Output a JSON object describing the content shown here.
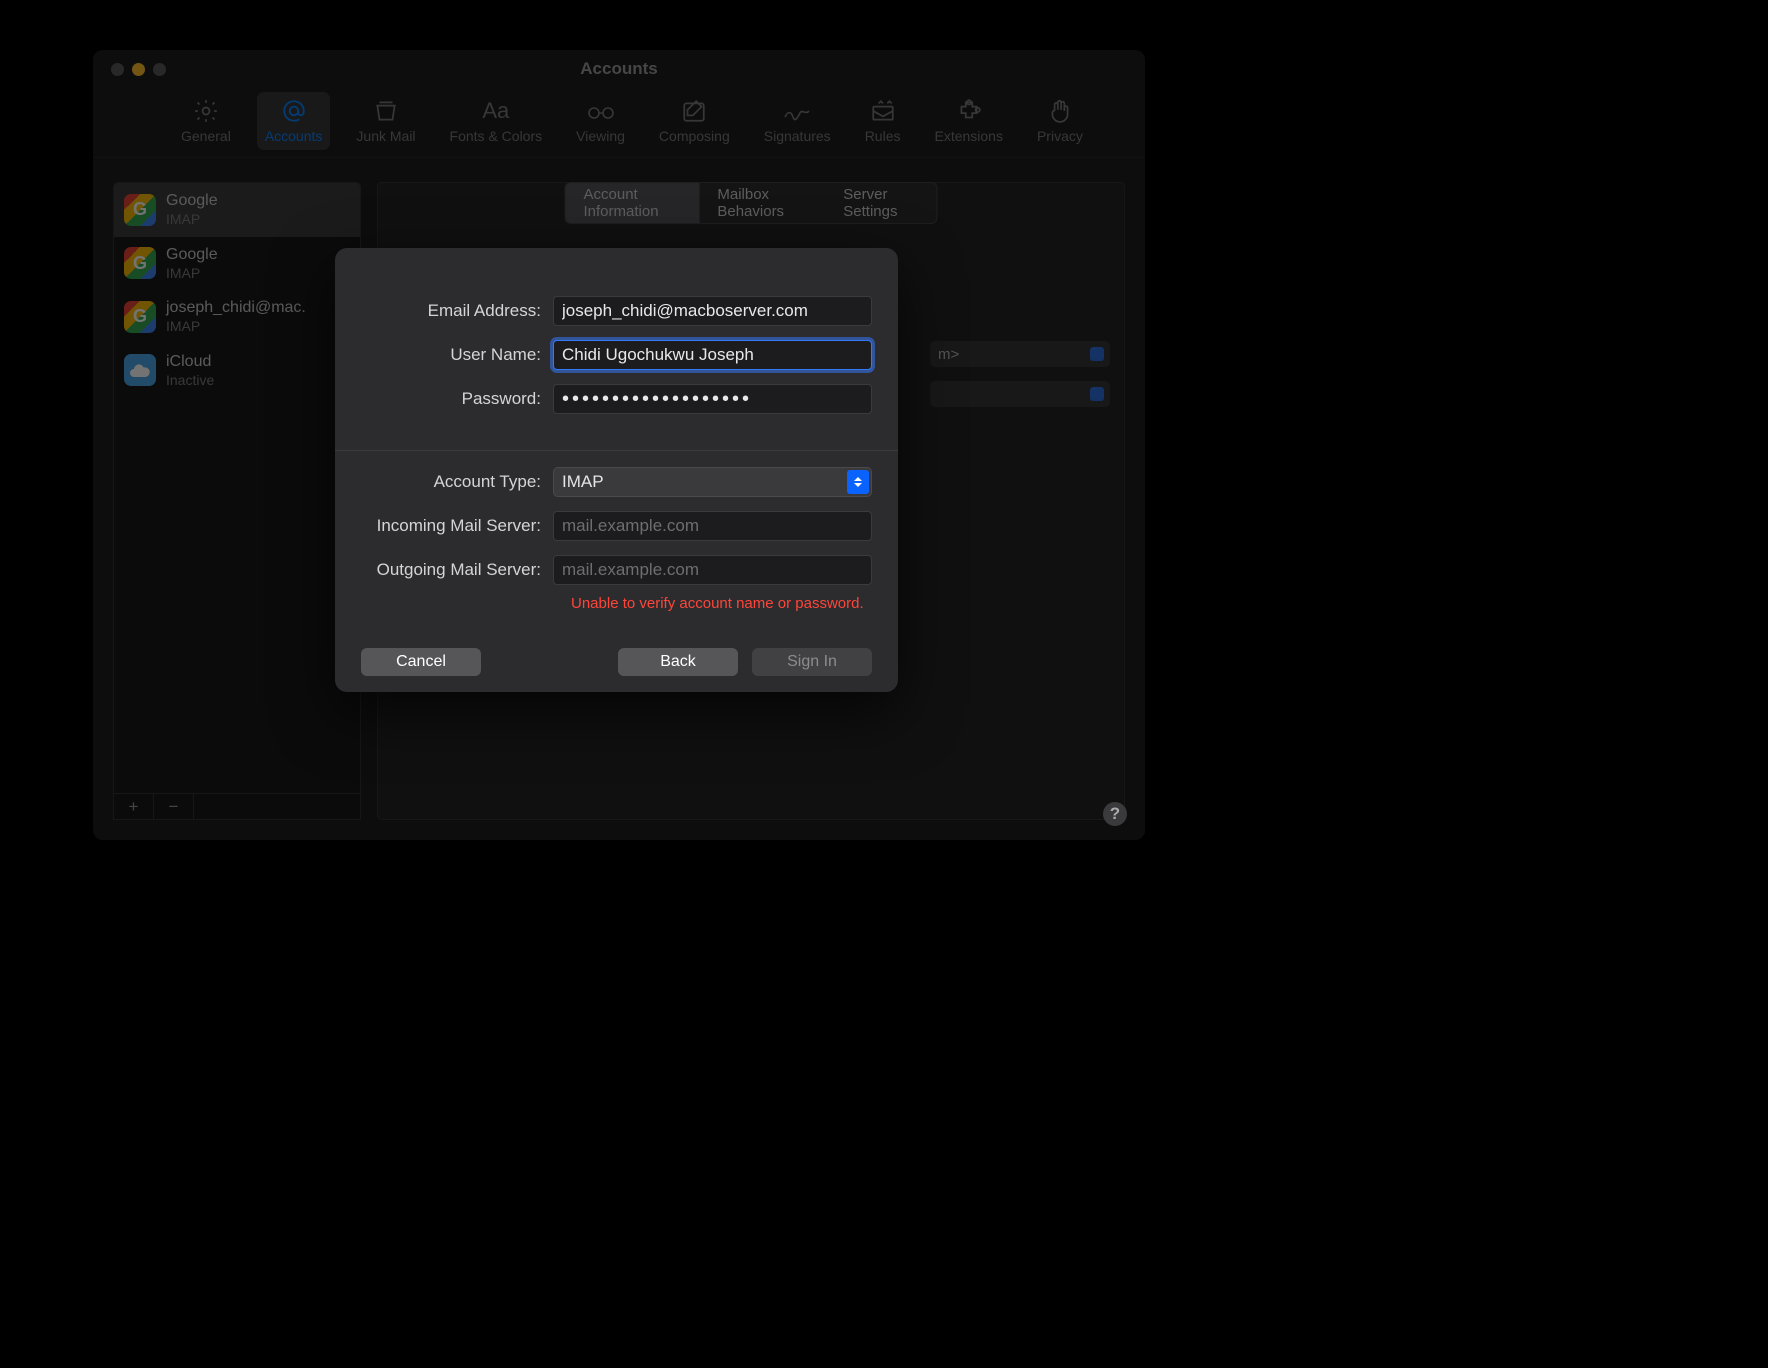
{
  "window": {
    "title": "Accounts"
  },
  "toolbar": {
    "items": [
      {
        "label": "General"
      },
      {
        "label": "Accounts"
      },
      {
        "label": "Junk Mail"
      },
      {
        "label": "Fonts & Colors"
      },
      {
        "label": "Viewing"
      },
      {
        "label": "Composing"
      },
      {
        "label": "Signatures"
      },
      {
        "label": "Rules"
      },
      {
        "label": "Extensions"
      },
      {
        "label": "Privacy"
      }
    ]
  },
  "sidebar": {
    "accounts": [
      {
        "title": "Google",
        "sub": "IMAP"
      },
      {
        "title": "Google",
        "sub": "IMAP"
      },
      {
        "title": "joseph_chidi@mac.",
        "sub": "IMAP"
      },
      {
        "title": "iCloud",
        "sub": "Inactive"
      }
    ],
    "add": "+",
    "remove": "−"
  },
  "tabs": {
    "items": [
      {
        "label": "Account Information"
      },
      {
        "label": "Mailbox Behaviors"
      },
      {
        "label": "Server Settings"
      }
    ]
  },
  "peek_select": "m>",
  "dialog": {
    "labels": {
      "email": "Email Address:",
      "user": "User Name:",
      "password": "Password:",
      "account_type": "Account Type:",
      "incoming": "Incoming Mail Server:",
      "outgoing": "Outgoing Mail Server:"
    },
    "values": {
      "email": "joseph_chidi@macboserver.com",
      "user": "Chidi Ugochukwu Joseph",
      "password": "•••••••••••••••••••",
      "account_type": "IMAP",
      "incoming_placeholder": "mail.example.com",
      "outgoing_placeholder": "mail.example.com"
    },
    "error": "Unable to verify account name or password.",
    "buttons": {
      "cancel": "Cancel",
      "back": "Back",
      "signin": "Sign In"
    }
  },
  "help": "?"
}
